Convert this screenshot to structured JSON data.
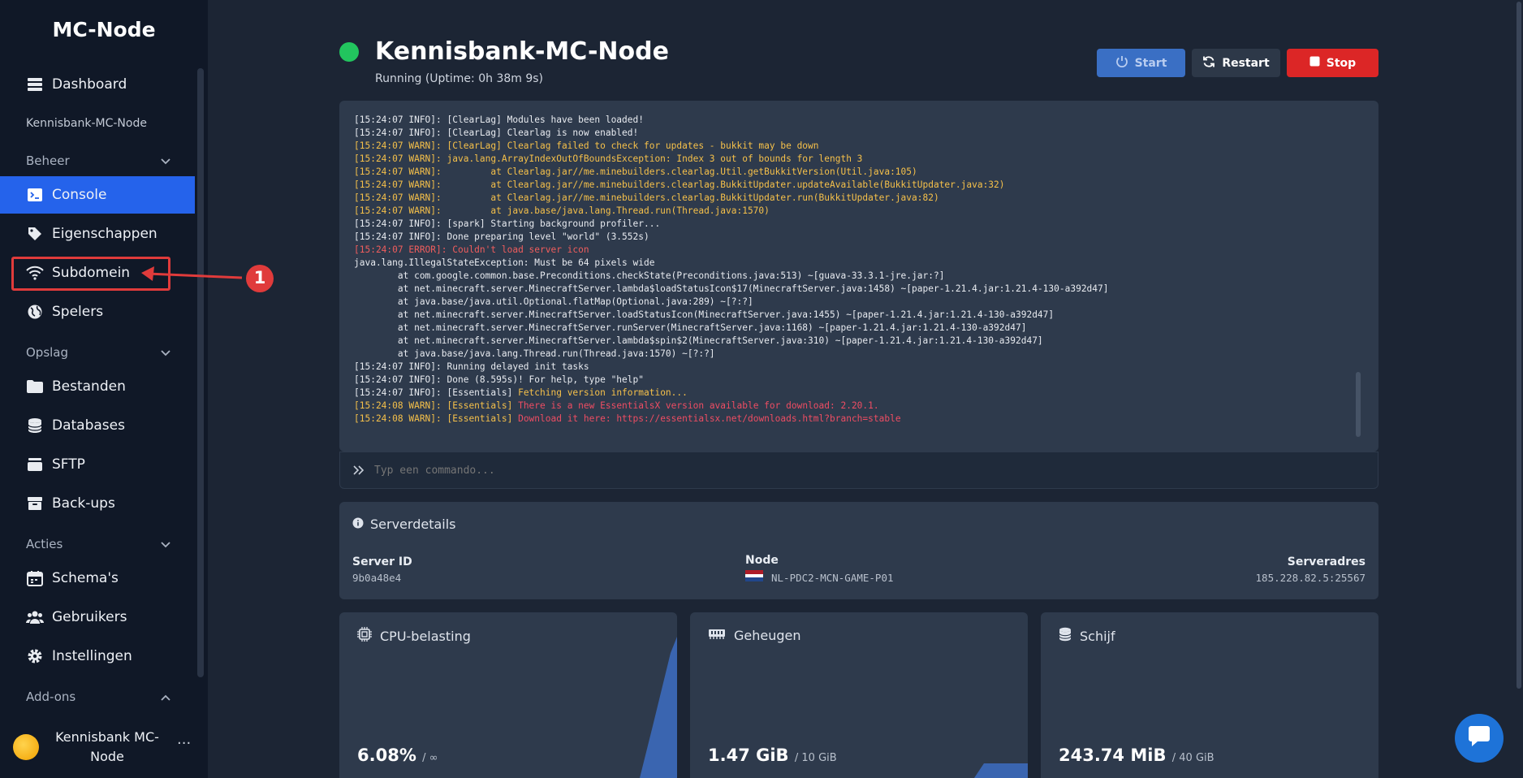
{
  "sidebar": {
    "brand": "MC-Node",
    "dashboard": "Dashboard",
    "server_name": "Kennisbank-MC-Node",
    "groups": {
      "beheer": "Beheer",
      "opslag": "Opslag",
      "acties": "Acties",
      "addons": "Add-ons"
    },
    "items": {
      "console": "Console",
      "eigenschappen": "Eigenschappen",
      "subdomein": "Subdomein",
      "spelers": "Spelers",
      "bestanden": "Bestanden",
      "databases": "Databases",
      "sftp": "SFTP",
      "backups": "Back-ups",
      "schemas": "Schema's",
      "gebruikers": "Gebruikers",
      "instellingen": "Instellingen"
    },
    "user": {
      "line1": "Kennisbank MC-",
      "line2": "Node",
      "menu": "···"
    }
  },
  "annotation": {
    "marker": "1",
    "color": "#e03b3b"
  },
  "header": {
    "title": "Kennisbank-MC-Node",
    "status": "Running (Uptime: 0h 38m 9s)",
    "start": "Start",
    "restart": "Restart",
    "stop": "Stop"
  },
  "console": {
    "lines": [
      {
        "type": "info",
        "text": "[15:24:07 INFO]: [ClearLag] Modules have been loaded!"
      },
      {
        "type": "info",
        "text": "[15:24:07 INFO]: [ClearLag] Clearlag is now enabled!"
      },
      {
        "type": "warn",
        "text": "[15:24:07 WARN]: [ClearLag] Clearlag failed to check for updates - bukkit may be down"
      },
      {
        "type": "warn",
        "text": "[15:24:07 WARN]: java.lang.ArrayIndexOutOfBoundsException: Index 3 out of bounds for length 3"
      },
      {
        "type": "warn",
        "text": "[15:24:07 WARN]:         at Clearlag.jar//me.minebuilders.clearlag.Util.getBukkitVersion(Util.java:105)"
      },
      {
        "type": "warn",
        "text": "[15:24:07 WARN]:         at Clearlag.jar//me.minebuilders.clearlag.BukkitUpdater.updateAvailable(BukkitUpdater.java:32)"
      },
      {
        "type": "warn",
        "text": "[15:24:07 WARN]:         at Clearlag.jar//me.minebuilders.clearlag.BukkitUpdater.run(BukkitUpdater.java:82)"
      },
      {
        "type": "warn",
        "text": "[15:24:07 WARN]:         at java.base/java.lang.Thread.run(Thread.java:1570)"
      },
      {
        "type": "info",
        "text": "[15:24:07 INFO]: [spark] Starting background profiler..."
      },
      {
        "type": "info",
        "text": "[15:24:07 INFO]: Done preparing level \"world\" (3.552s)"
      },
      {
        "type": "error",
        "text": "[15:24:07 ERROR]: Couldn't load server icon"
      },
      {
        "type": "info",
        "text": "java.lang.IllegalStateException: Must be 64 pixels wide"
      },
      {
        "type": "info",
        "text": "        at com.google.common.base.Preconditions.checkState(Preconditions.java:513) ~[guava-33.3.1-jre.jar:?]"
      },
      {
        "type": "info",
        "text": "        at net.minecraft.server.MinecraftServer.lambda$loadStatusIcon$17(MinecraftServer.java:1458) ~[paper-1.21.4.jar:1.21.4-130-a392d47]"
      },
      {
        "type": "info",
        "text": "        at java.base/java.util.Optional.flatMap(Optional.java:289) ~[?:?]"
      },
      {
        "type": "info",
        "text": "        at net.minecraft.server.MinecraftServer.loadStatusIcon(MinecraftServer.java:1455) ~[paper-1.21.4.jar:1.21.4-130-a392d47]"
      },
      {
        "type": "info",
        "text": "        at net.minecraft.server.MinecraftServer.runServer(MinecraftServer.java:1168) ~[paper-1.21.4.jar:1.21.4-130-a392d47]"
      },
      {
        "type": "info",
        "text": "        at net.minecraft.server.MinecraftServer.lambda$spin$2(MinecraftServer.java:310) ~[paper-1.21.4.jar:1.21.4-130-a392d47]"
      },
      {
        "type": "info",
        "text": "        at java.base/java.lang.Thread.run(Thread.java:1570) ~[?:?]"
      },
      {
        "type": "info",
        "text": "[15:24:07 INFO]: Running delayed init tasks"
      },
      {
        "type": "info",
        "text": "[15:24:07 INFO]: Done (8.595s)! For help, type \"help\""
      },
      {
        "type": "info-warnmsg",
        "prefix": "[15:24:07 INFO]: [Essentials] ",
        "text": "Fetching version information..."
      },
      {
        "type": "ess",
        "prefix": "[15:24:08 WARN]: [Essentials] ",
        "text": "There is a new EssentialsX version available for download: 2.20.1."
      },
      {
        "type": "ess",
        "prefix": "[15:24:08 WARN]: [Essentials] ",
        "text": "Download it here: https://essentialsx.net/downloads.html?branch=stable"
      }
    ],
    "placeholder": "Typ een commando..."
  },
  "details": {
    "title": "Serverdetails",
    "server_id_label": "Server ID",
    "server_id": "9b0a48e4",
    "node_label": "Node",
    "node": "NL-PDC2-MCN-GAME-P01",
    "address_label": "Serveradres",
    "address": "185.228.82.5:25567"
  },
  "stats": {
    "cpu": {
      "title": "CPU-belasting",
      "value": "6.08%",
      "limit": "/ ∞"
    },
    "memory": {
      "title": "Geheugen",
      "value": "1.47 GiB",
      "limit": "/ 10 GiB"
    },
    "disk": {
      "title": "Schijf",
      "value": "243.74 MiB",
      "limit": "/ 40 GiB"
    }
  },
  "colors": {
    "accent": "#2563eb",
    "success": "#22c55e",
    "danger": "#dc2626",
    "warn_text": "#f5c04a",
    "error_text": "#f05d5d"
  }
}
